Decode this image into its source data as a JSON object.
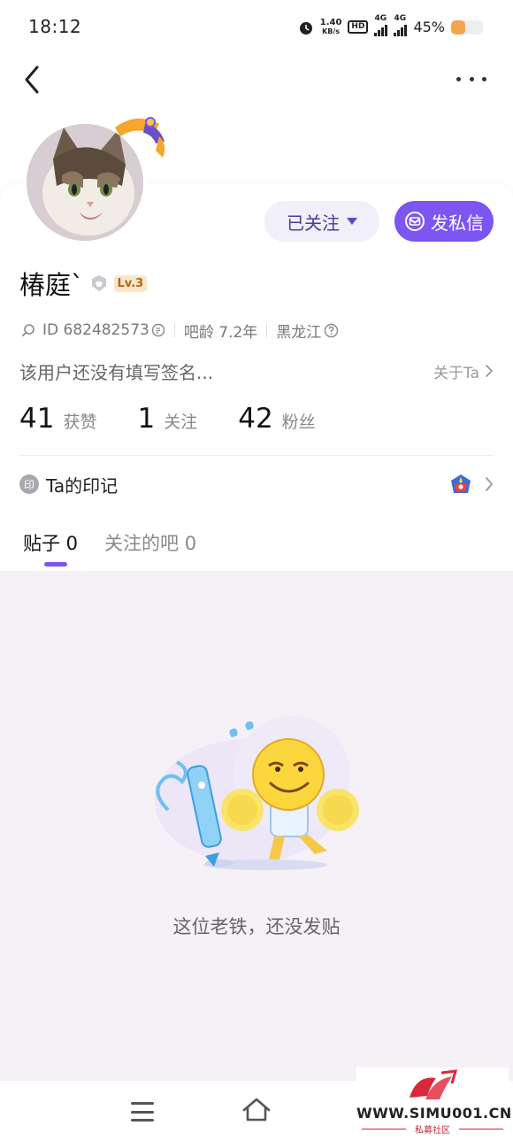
{
  "status_bar": {
    "time": "18:12",
    "net_speed_value": "1.40",
    "net_speed_unit": "KB/s",
    "hd_label": "HD",
    "signal_1": "4G",
    "signal_2": "4G",
    "battery_percent_text": "45%",
    "battery_level": 0.45
  },
  "profile": {
    "username": "椿庭`",
    "level": "Lv.3",
    "id_text": "ID 682482573",
    "bar_age": "吧龄 7.2年",
    "region": "黑龙江",
    "signature": "该用户还没有填写签名...",
    "about_link": "关于Ta"
  },
  "actions": {
    "following_label": "已关注",
    "message_label": "发私信"
  },
  "stats": [
    {
      "value": "41",
      "label": "获赞"
    },
    {
      "value": "1",
      "label": "关注"
    },
    {
      "value": "42",
      "label": "粉丝"
    }
  ],
  "marks": {
    "icon_char": "印",
    "label": "Ta的印记"
  },
  "tabs": [
    {
      "label": "贴子 0",
      "active": true
    },
    {
      "label": "关注的吧 0",
      "active": false
    }
  ],
  "empty_state": {
    "text": "这位老铁，还没发贴"
  },
  "watermark": {
    "url": "WWW.SIMU001.CN",
    "sub": "私募社区"
  },
  "colors": {
    "accent": "#7c55f2",
    "content_bg": "#f5f1f6",
    "battery": "#f5a64a"
  }
}
